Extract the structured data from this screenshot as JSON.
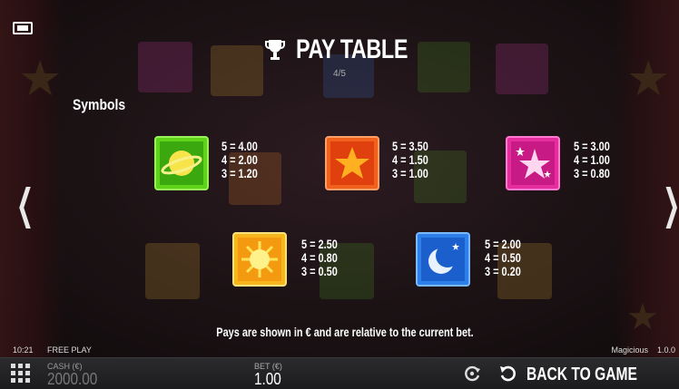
{
  "header": {
    "title": "PAY TABLE",
    "page_indicator": "4/5"
  },
  "section": {
    "label": "Symbols"
  },
  "symbols": [
    {
      "icon": "planet-icon",
      "color": "#5fd21a",
      "pays": [
        "5 = 4.00",
        "4 = 2.00",
        "3 = 1.20"
      ]
    },
    {
      "icon": "star-icon",
      "color": "#f0621c",
      "pays": [
        "5 = 3.50",
        "4 = 1.50",
        "3 = 1.00"
      ]
    },
    {
      "icon": "sparkle-star-icon",
      "color": "#e62d9e",
      "pays": [
        "5 = 3.00",
        "4 = 1.00",
        "3 = 0.80"
      ]
    },
    {
      "icon": "sun-icon",
      "color": "#f6b61d",
      "pays": [
        "5 = 2.50",
        "4 = 0.80",
        "3 = 0.50"
      ]
    },
    {
      "icon": "moon-icon",
      "color": "#2f7fe8",
      "pays": [
        "5 = 2.00",
        "4 = 0.50",
        "3 = 0.20"
      ]
    }
  ],
  "footer_note": "Pays are shown in € and are relative to the current bet.",
  "status": {
    "time": "10:21",
    "mode": "FREE PLAY",
    "game_name": "Magicious",
    "version": "1.0.0"
  },
  "bottom_bar": {
    "cash_label": "CASH (€)",
    "cash_value": "2000.00",
    "bet_label": "BET (€)",
    "bet_value": "1.00",
    "back_label": "BACK TO GAME"
  }
}
